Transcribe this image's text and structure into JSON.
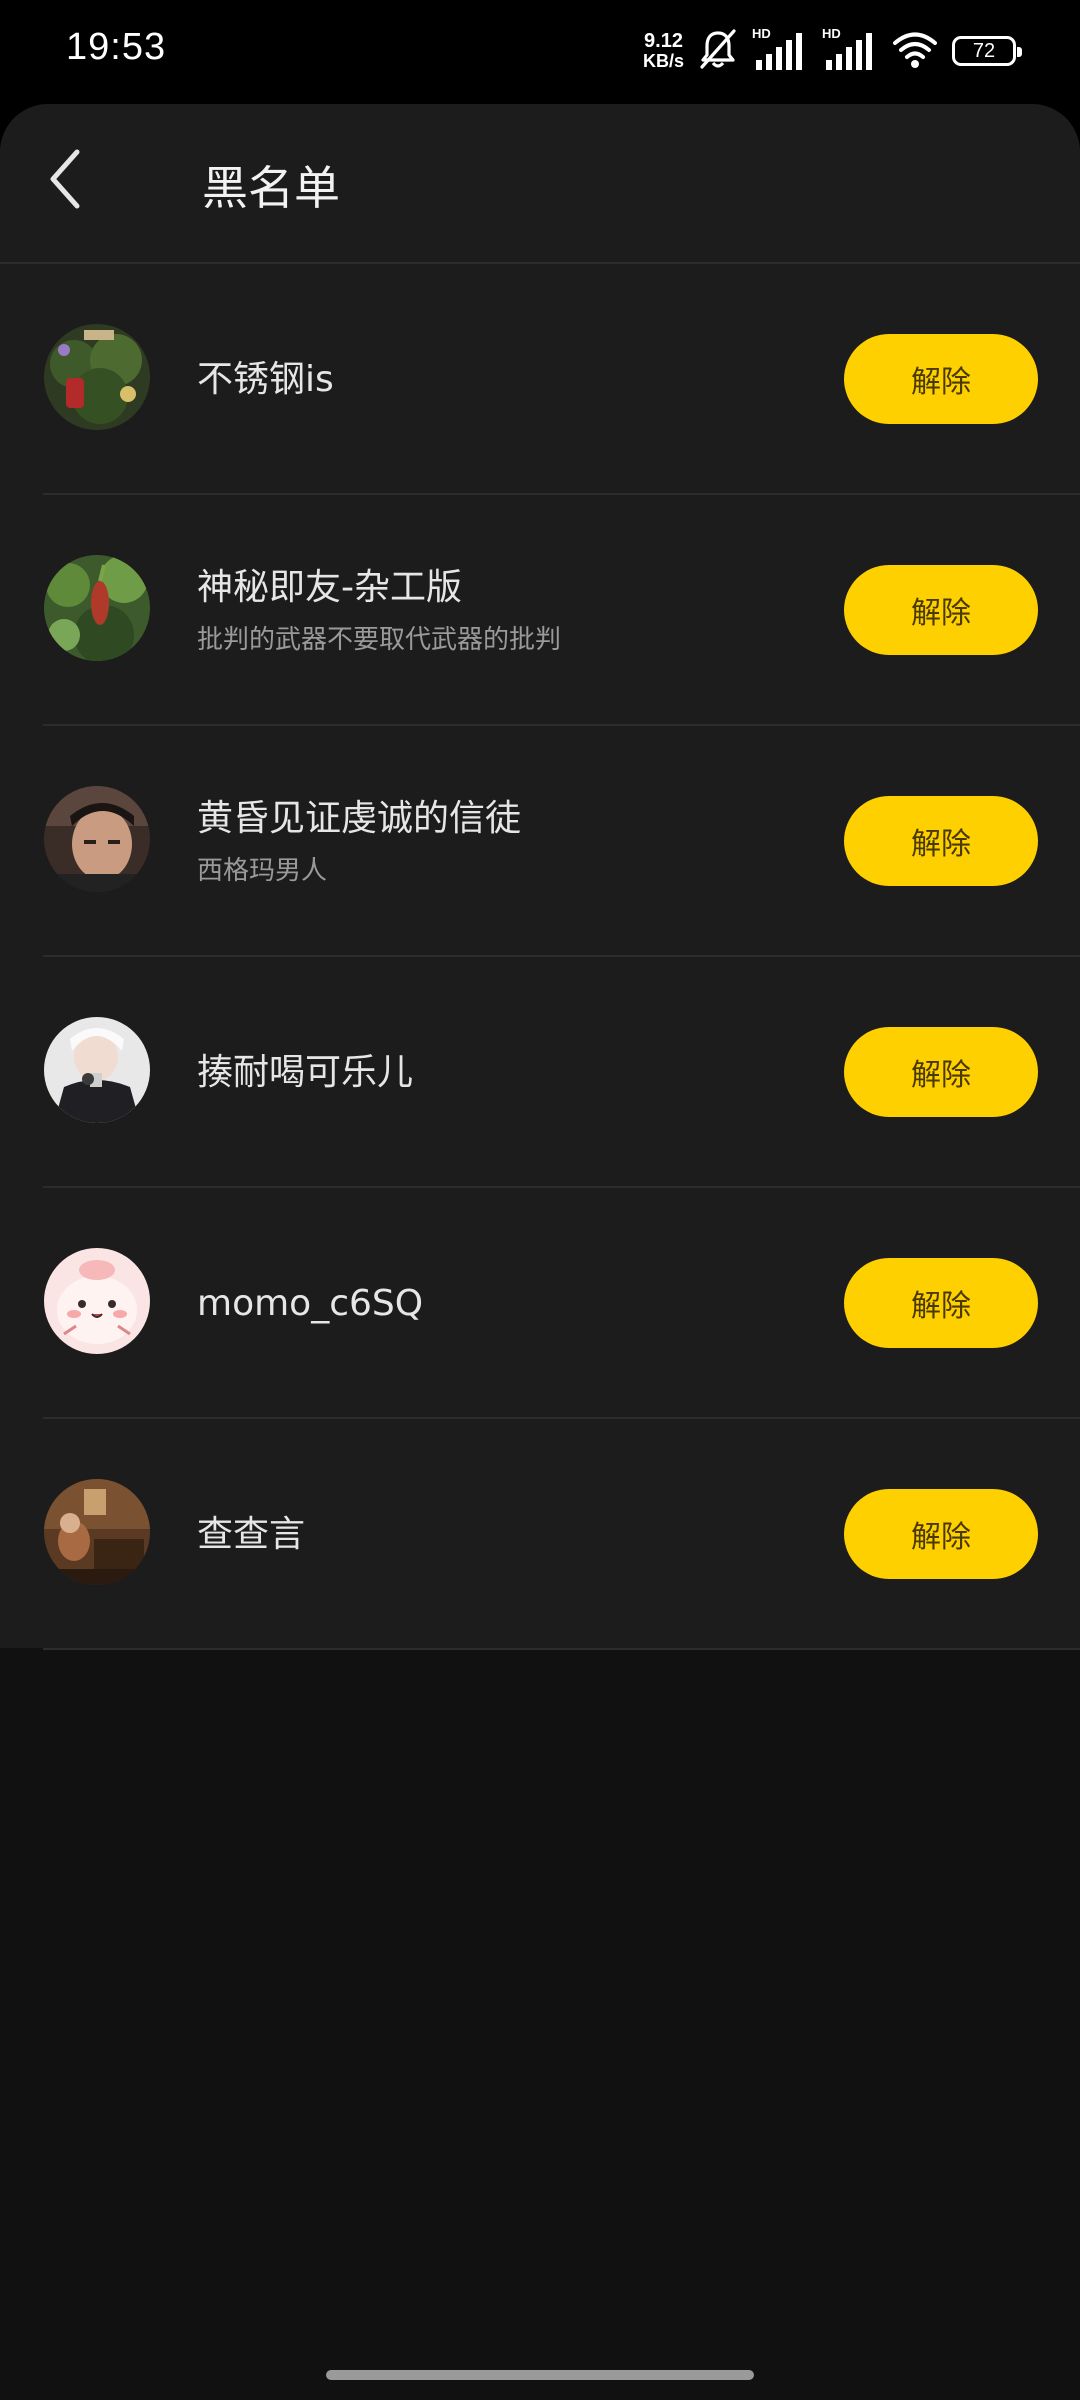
{
  "status_bar": {
    "time": "19:53",
    "net_speed_value": "9.12",
    "net_speed_unit": "KB/s",
    "hd_label_1": "HD",
    "hd_label_2": "HD",
    "battery": "72",
    "icons": [
      "bell-muted-icon",
      "signal-icon",
      "signal-icon",
      "wifi-icon",
      "battery-icon"
    ]
  },
  "header": {
    "title": "黑名单",
    "back_icon": "chevron-left-icon"
  },
  "blacklist": [
    {
      "name": "不锈钢is",
      "signature": "",
      "button": "解除"
    },
    {
      "name": "神秘即友-杂工版",
      "signature": "批判的武器不要取代武器的批判",
      "button": "解除"
    },
    {
      "name": "黄昏见证虔诚的信徒",
      "signature": "西格玛男人",
      "button": "解除"
    },
    {
      "name": "揍耐喝可乐儿",
      "signature": "",
      "button": "解除"
    },
    {
      "name": "momo_c6SQ",
      "signature": "",
      "button": "解除"
    },
    {
      "name": "查查言",
      "signature": "",
      "button": "解除"
    }
  ],
  "colors": {
    "accent": "#ffd000",
    "panel": "#1c1c1c",
    "background": "#111111"
  }
}
